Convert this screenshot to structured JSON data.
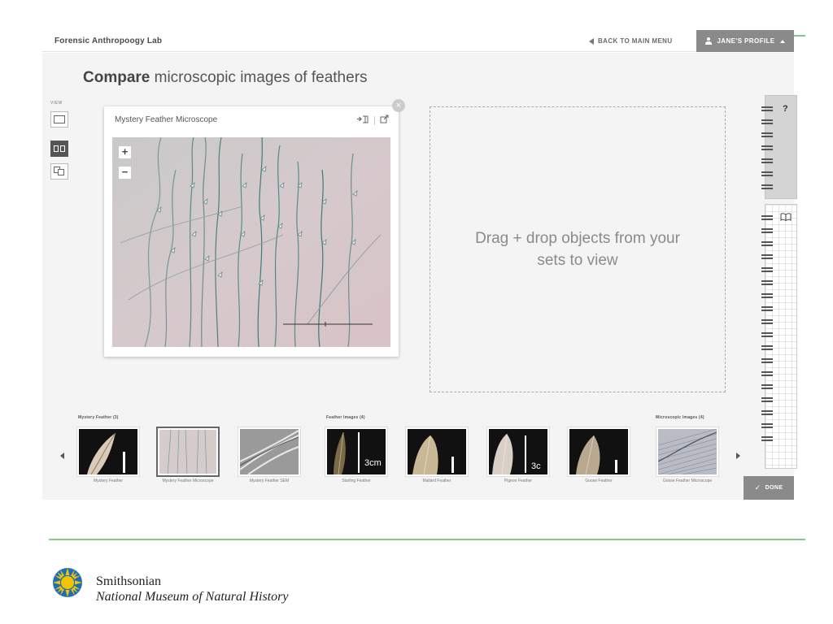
{
  "header": {
    "app_title": "Forensic Anthropoogy Lab",
    "back_label": "BACK TO MAIN MENU",
    "profile_label": "JANE'S PROFILE"
  },
  "page": {
    "heading_bold": "Compare",
    "heading_rest": " microscopic images of feathers"
  },
  "view_controls": {
    "label": "VIEW",
    "modes": [
      "single-view",
      "split-view",
      "overlay-view"
    ],
    "active": "split-view"
  },
  "viewer": {
    "title": "Mystery Feather Microscope",
    "zoom_in": "+",
    "zoom_out": "−",
    "close": "×"
  },
  "dropzone": {
    "text": "Drag + drop objects from your sets to view"
  },
  "sidebar": {
    "help_label": "?",
    "done_label": "DONE"
  },
  "sets": [
    {
      "label": "Mystery Feather (3)"
    },
    {
      "label": "Feather Images (4)"
    },
    {
      "label": "Microscopic Images (4)"
    }
  ],
  "thumbnails": [
    {
      "caption": "Mystery Feather",
      "selected": false
    },
    {
      "caption": "Mystery Feather Microscope",
      "selected": true
    },
    {
      "caption": "Mystery Feather SEM",
      "selected": false
    },
    {
      "caption": "Starling Feather",
      "scale_label": "3cm",
      "selected": false
    },
    {
      "caption": "Mallard Feather",
      "selected": false
    },
    {
      "caption": "Pigeon Feather",
      "scale_label": "3c",
      "selected": false
    },
    {
      "caption": "Goose Feather",
      "selected": false
    },
    {
      "caption": "Goose Feather Microscope",
      "selected": false
    }
  ],
  "footer": {
    "org_line1": "Smithsonian",
    "org_line2": "National Museum of Natural History"
  },
  "colors": {
    "accent_green": "#8cc58a",
    "button_gray": "#8a8a8a",
    "logo_yellow": "#f5c400",
    "logo_blue": "#1f6fb8"
  }
}
